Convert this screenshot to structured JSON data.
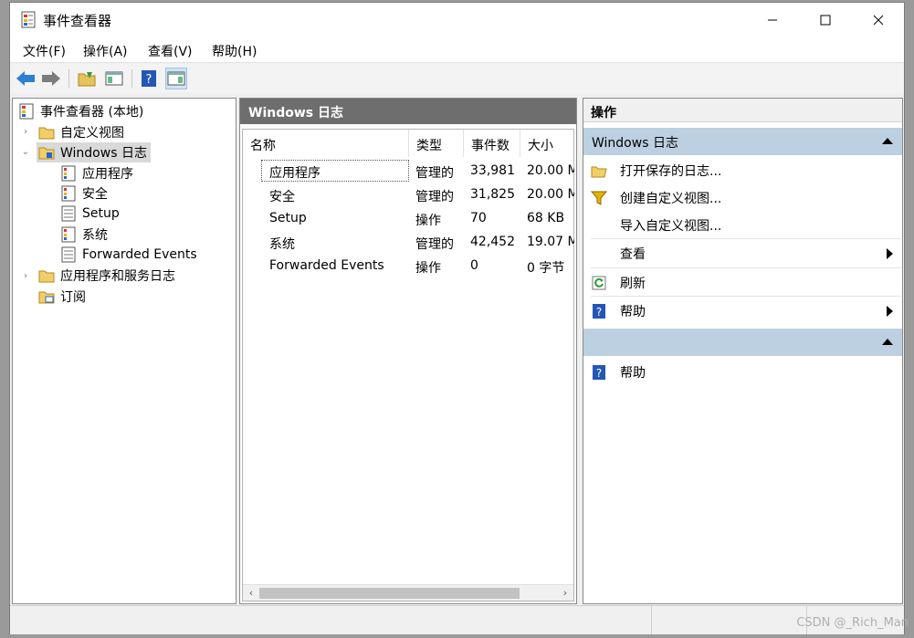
{
  "window": {
    "title": "事件查看器",
    "icon": "event-viewer-icon"
  },
  "menu": [
    {
      "label": "文件(F)"
    },
    {
      "label": "操作(A)"
    },
    {
      "label": "查看(V)"
    },
    {
      "label": "帮助(H)"
    }
  ],
  "toolbar": {
    "buttons": [
      "back-arrow-icon",
      "forward-arrow-icon",
      "open-folder-icon",
      "show-pane-icon",
      "help-icon",
      "action-pane-icon"
    ]
  },
  "tree": {
    "items": [
      {
        "label": "事件查看器 (本地)",
        "icon": "event-viewer-icon"
      },
      {
        "label": "自定义视图",
        "icon": "folder-icon"
      },
      {
        "label": "Windows 日志",
        "icon": "folder-icon"
      },
      {
        "label": "应用程序",
        "icon": "log-icon"
      },
      {
        "label": "安全",
        "icon": "log-icon"
      },
      {
        "label": "Setup",
        "icon": "log-icon"
      },
      {
        "label": "系统",
        "icon": "log-icon"
      },
      {
        "label": "Forwarded Events",
        "icon": "log-icon"
      },
      {
        "label": "应用程序和服务日志",
        "icon": "folder-icon"
      },
      {
        "label": "订阅",
        "icon": "subscription-icon"
      }
    ]
  },
  "middle": {
    "header": "Windows 日志",
    "columns": [
      "名称",
      "类型",
      "事件数",
      "大小"
    ],
    "rows": [
      {
        "name": "应用程序",
        "type": "管理的",
        "count": "33,981",
        "size": "20.00 M"
      },
      {
        "name": "安全",
        "type": "管理的",
        "count": "31,825",
        "size": "20.00 M"
      },
      {
        "name": "Setup",
        "type": "操作",
        "count": "70",
        "size": "68 KB"
      },
      {
        "name": "系统",
        "type": "管理的",
        "count": "42,452",
        "size": "19.07 M"
      },
      {
        "name": "Forwarded Events",
        "type": "操作",
        "count": "0",
        "size": "0 字节"
      }
    ]
  },
  "actions": {
    "title": "操作",
    "section1": "Windows 日志",
    "items": [
      {
        "label": "打开保存的日志...",
        "icon": "open-folder-icon"
      },
      {
        "label": "创建自定义视图...",
        "icon": "filter-icon"
      },
      {
        "label": "导入自定义视图...",
        "icon": ""
      },
      {
        "label": "查看",
        "icon": ""
      },
      {
        "label": "刷新",
        "icon": "refresh-icon"
      },
      {
        "label": "帮助",
        "icon": "help-icon"
      }
    ],
    "section2": "",
    "items2": [
      {
        "label": "帮助",
        "icon": "help-icon"
      }
    ]
  },
  "watermark": "CSDN @_Rich_Man",
  "colors": {
    "section": "#bdd0e2",
    "header": "#6e6e6e"
  }
}
